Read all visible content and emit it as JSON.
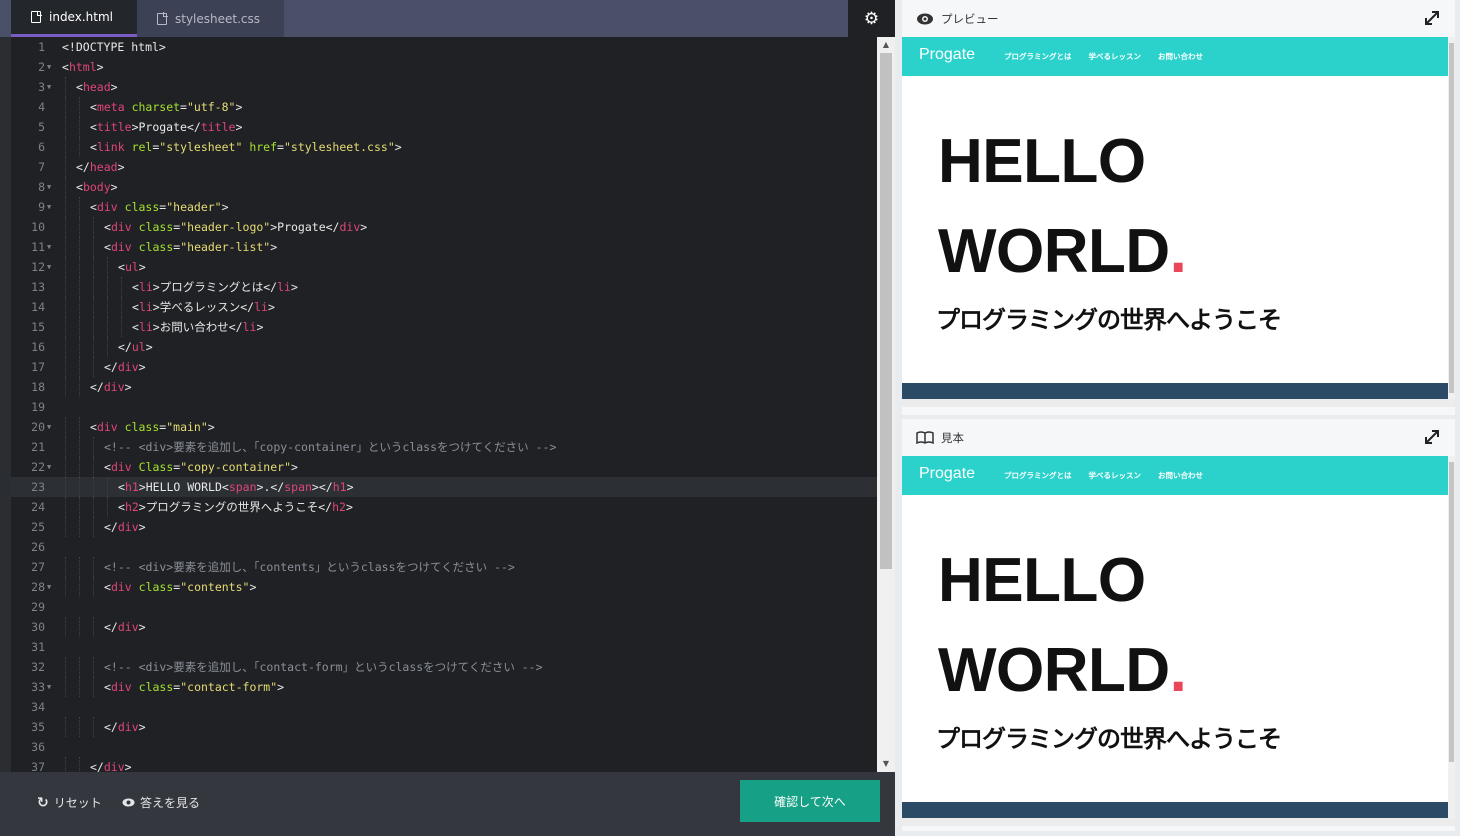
{
  "tabs": [
    {
      "label": "index.html"
    },
    {
      "label": "stylesheet.css"
    }
  ],
  "code_lines": [
    "<!DOCTYPE html>",
    "<html>",
    "<head>",
    "<meta charset=\"utf-8\">",
    "<title>Progate</title>",
    "<link rel=\"stylesheet\" href=\"stylesheet.css\">",
    "</head>",
    "<body>",
    "<div class=\"header\">",
    "<div class=\"header-logo\">Progate</div>",
    "<div class=\"header-list\">",
    "<ul>",
    "<li>プログラミングとは</li>",
    "<li>学べるレッスン</li>",
    "<li>お問い合わせ</li>",
    "</ul>",
    "</div>",
    "</div>",
    "",
    "<div class=\"main\">",
    "<!-- <div>要素を追加し、「copy-container」というclassをつけてください -->",
    "<div Class=\"copy-container\">",
    "<h1>HELLO WORLD<span>.</span></h1>",
    "<h2>プログラミングの世界へようこそ</h2>",
    "</div>",
    "",
    "<!-- <div>要素を追加し、「contents」というclassをつけてください -->",
    "<div class=\"contents\">",
    "",
    "</div>",
    "",
    "<!-- <div>要素を追加し、「contact-form」というclassをつけてください -->",
    "<div class=\"contact-form\">",
    "",
    "</div>",
    "",
    "</div>"
  ],
  "footer": {
    "reset_label": "リセット",
    "answer_label": "答えを見る",
    "next_label": "確認して次へ"
  },
  "preview": {
    "label": "プレビュー",
    "logo": "Progate",
    "nav": [
      "プログラミングとは",
      "学べるレッスン",
      "お問い合わせ"
    ],
    "h1_line1": "HELLO",
    "h1_line2": "WORLD",
    "h1_dot": ".",
    "h2": "プログラミングの世界へようこそ"
  },
  "sample": {
    "label": "見本",
    "logo": "Progate",
    "nav": [
      "プログラミングとは",
      "学べるレッスン",
      "お問い合わせ"
    ],
    "h1_line1": "HELLO",
    "h1_line2": "WORLD",
    "h1_dot": ".",
    "h2": "プログラミングの世界へようこそ"
  },
  "colors": {
    "tag": "#e0457b",
    "attr": "#a6e22e",
    "string": "#e6db74",
    "site_header": "#2bd2cb",
    "accent_dot": "#e9465a",
    "primary_button": "#16a085"
  }
}
